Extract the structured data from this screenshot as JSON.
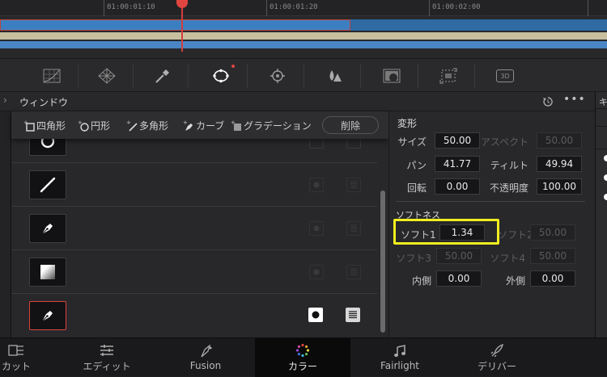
{
  "timeline": {
    "timecodes": [
      "01:00:01:10",
      "01:00:01:20",
      "01:00:02:00"
    ]
  },
  "toolbar": {
    "tools": [
      "curves-icon",
      "warper-icon",
      "qualifier-eyedropper-icon",
      "window-icon",
      "tracker-icon",
      "blur-icon",
      "key-icon",
      "sizing-icon",
      "3d-icon"
    ],
    "badge_3d": "3D"
  },
  "panel": {
    "title": "ウィンドウ"
  },
  "shape_tools": {
    "square": "四角形",
    "circle": "円形",
    "polygon": "多角形",
    "curve": "カーブ",
    "gradient": "グラデーション",
    "delete": "削除"
  },
  "inspector": {
    "transform_title": "変形",
    "size_label": "サイズ",
    "size_value": "50.00",
    "aspect_label": "アスペクト",
    "aspect_value": "50.00",
    "pan_label": "パン",
    "pan_value": "41.77",
    "tilt_label": "ティルト",
    "tilt_value": "49.94",
    "rotate_label": "回転",
    "rotate_value": "0.00",
    "opacity_label": "不透明度",
    "opacity_value": "100.00",
    "softness_title": "ソフトネス",
    "soft1_label": "ソフト1",
    "soft1_value": "1.34",
    "soft2_label": "ソフト2",
    "soft2_value": "50.00",
    "soft3_label": "ソフト3",
    "soft3_value": "50.00",
    "soft4_label": "ソフト4",
    "soft4_value": "50.00",
    "inside_label": "内側",
    "inside_value": "0.00",
    "outside_label": "外側",
    "outside_value": "0.00"
  },
  "pages": {
    "cut": "カット",
    "edit": "エディット",
    "fusion": "Fusion",
    "color": "カラー",
    "fairlight": "Fairlight",
    "deliver": "デリバー"
  },
  "colors": {
    "highlight": "#f2ee1e",
    "accent_red": "#e0453f",
    "selected_row_border": "#d9453c"
  }
}
